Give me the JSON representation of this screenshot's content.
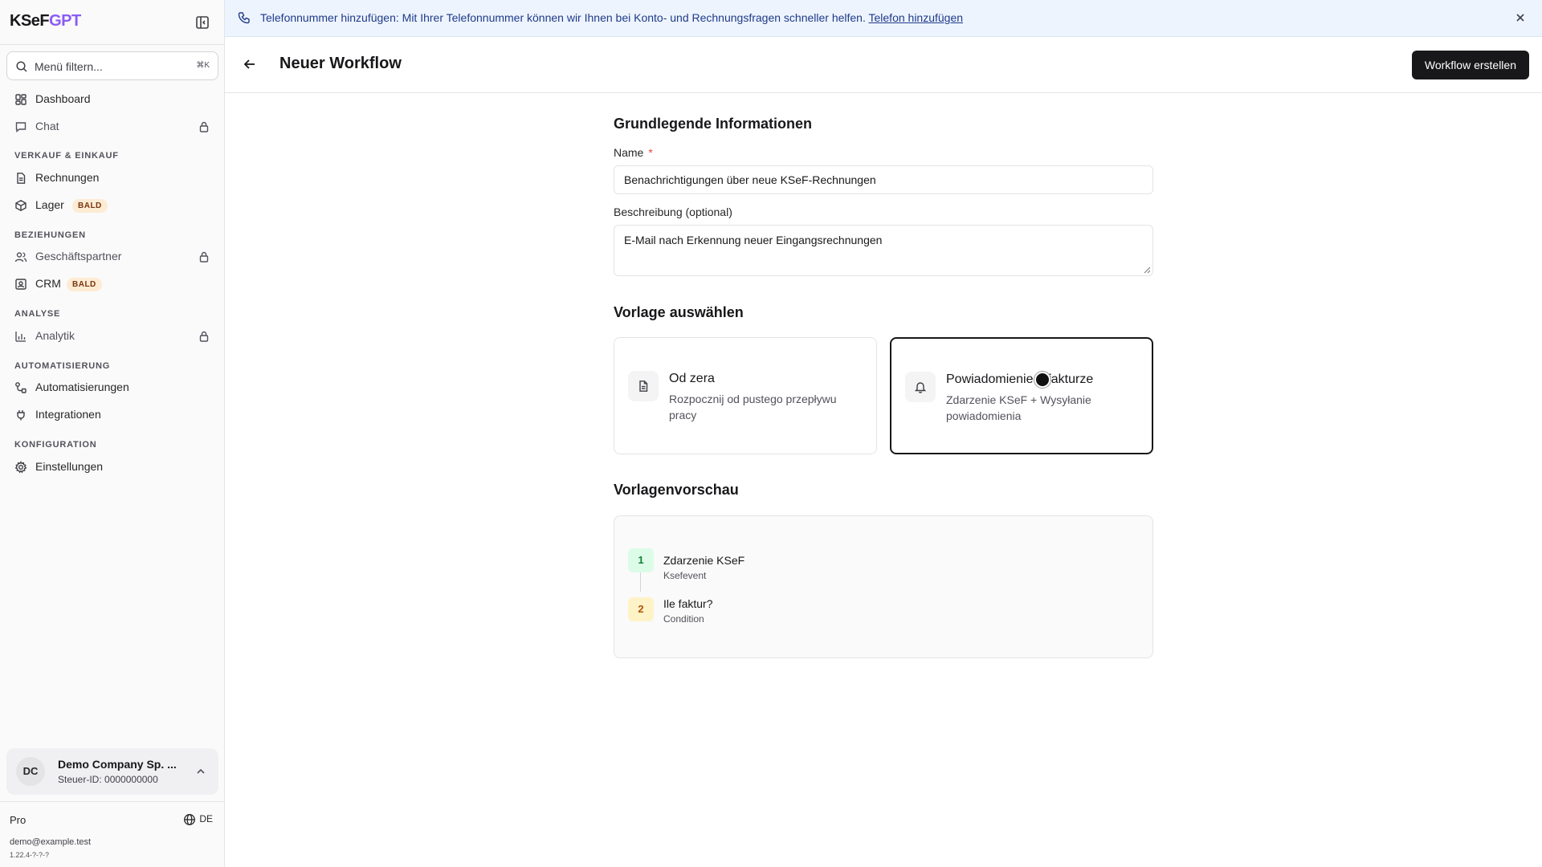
{
  "app": {
    "logo_k": "KSeF",
    "logo_g": "GPT"
  },
  "sidebar": {
    "filter_placeholder": "Menü filtern...",
    "filter_shortcut": "⌘K",
    "items": [
      {
        "label": "Dashboard",
        "icon": "grid-icon"
      },
      {
        "label": "Chat",
        "icon": "message-icon",
        "locked": true
      },
      {
        "label": "Rechnungen",
        "icon": "file-icon"
      },
      {
        "label": "Lager",
        "icon": "box-icon",
        "badge": "BALD"
      },
      {
        "label": "Geschäftspartner",
        "icon": "users-icon",
        "locked": true
      },
      {
        "label": "CRM",
        "icon": "contact-icon",
        "badge": "BALD"
      },
      {
        "label": "Analytik",
        "icon": "bar-chart-icon",
        "locked": true
      },
      {
        "label": "Automatisierungen",
        "icon": "workflow-icon"
      },
      {
        "label": "Integrationen",
        "icon": "plug-icon"
      },
      {
        "label": "Einstellungen",
        "icon": "gear-icon"
      }
    ],
    "sections": {
      "sales": "VERKAUF & EINKAUF",
      "relations": "BEZIEHUNGEN",
      "analysis": "ANALYSE",
      "automation": "AUTOMATISIERUNG",
      "config": "KONFIGURATION"
    },
    "account": {
      "initials": "DC",
      "name": "Demo Company Sp. ...",
      "tax_id": "Steuer-ID: 0000000000"
    },
    "plan": "Pro",
    "language": "DE",
    "email": "demo@example.test",
    "version": "1.22.4-?-?-?"
  },
  "banner": {
    "text": "Telefonnummer hinzufügen: Mit Ihrer Telefonnummer können wir Ihnen bei Konto- und Rechnungsfragen schneller helfen.",
    "link": "Telefon hinzufügen"
  },
  "header": {
    "title": "Neuer Workflow",
    "create_button": "Workflow erstellen"
  },
  "form": {
    "section_title": "Grundlegende Informationen",
    "name_label": "Name",
    "name_required": "*",
    "name_value": "Benachrichtigungen über neue KSeF-Rechnungen",
    "description_label": "Beschreibung (optional)",
    "description_value": "E-Mail nach Erkennung neuer Eingangsrechnungen"
  },
  "templates": {
    "section_title": "Vorlage auswählen",
    "cards": [
      {
        "title": "Od zera",
        "description": "Rozpocznij od pustego przepływu pracy",
        "icon": "document-icon",
        "selected": false
      },
      {
        "title": "Powiadomienie o fakturze",
        "description": "Zdarzenie KSeF + Wysyłanie powiadomienia",
        "icon": "bell-icon",
        "selected": true
      }
    ]
  },
  "preview": {
    "section_title": "Vorlagenvorschau",
    "steps": [
      {
        "number": "1",
        "title": "Zdarzenie KSeF",
        "subtitle": "Ksefevent",
        "color": "#15803d"
      },
      {
        "number": "2",
        "title": "Ile faktur?",
        "subtitle": "Condition",
        "color": "#b45309"
      }
    ]
  }
}
